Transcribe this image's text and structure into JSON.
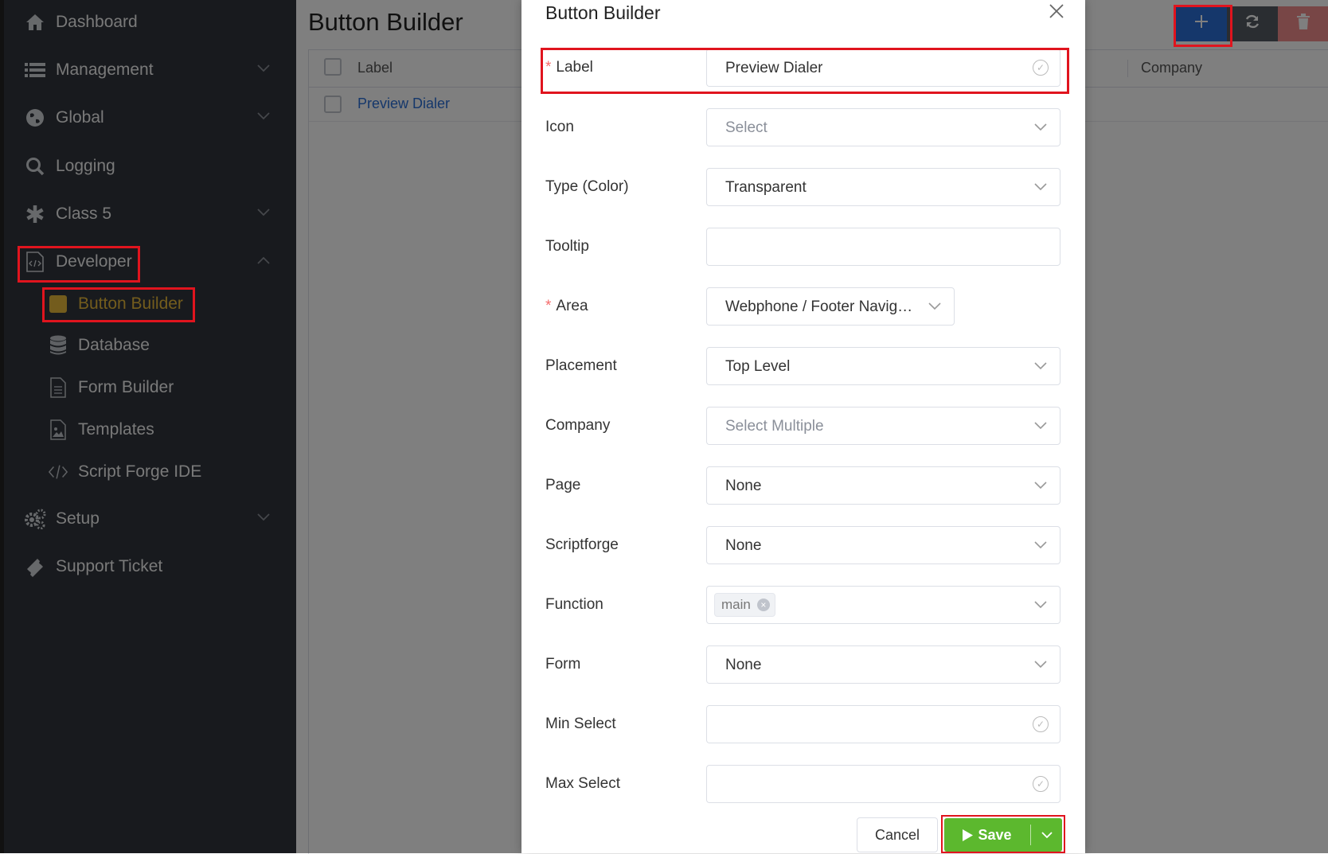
{
  "sidebar": {
    "items": [
      {
        "label": "Dashboard",
        "icon": "home-icon"
      },
      {
        "label": "Management",
        "icon": "list-icon"
      },
      {
        "label": "Global",
        "icon": "globe-icon"
      },
      {
        "label": "Logging",
        "icon": "search-icon"
      },
      {
        "label": "Class 5",
        "icon": "asterisk-icon"
      },
      {
        "label": "Developer",
        "icon": "code-file-icon"
      },
      {
        "label": "Setup",
        "icon": "gears-icon"
      },
      {
        "label": "Support Ticket",
        "icon": "ticket-icon"
      }
    ],
    "developer_sub": [
      {
        "label": "Button Builder",
        "icon": "button-builder-icon",
        "active": true
      },
      {
        "label": "Database",
        "icon": "database-icon"
      },
      {
        "label": "Form Builder",
        "icon": "document-icon"
      },
      {
        "label": "Templates",
        "icon": "image-file-icon"
      },
      {
        "label": "Script Forge IDE",
        "icon": "code-icon"
      }
    ]
  },
  "page": {
    "title": "Button Builder",
    "table": {
      "headers": {
        "label": "Label",
        "company": "Company"
      },
      "rows": [
        {
          "label": "Preview Dialer"
        }
      ]
    },
    "toolbar": {
      "add_icon": "plus-icon",
      "refresh_icon": "refresh-icon",
      "delete_icon": "trash-icon"
    }
  },
  "modal": {
    "title": "Button Builder",
    "fields": {
      "label": {
        "label": "Label",
        "value": "Preview Dialer",
        "required": true
      },
      "icon": {
        "label": "Icon",
        "placeholder": "Select"
      },
      "type": {
        "label": "Type (Color)",
        "value": "Transparent"
      },
      "tooltip": {
        "label": "Tooltip",
        "value": ""
      },
      "area": {
        "label": "Area",
        "value": "Webphone / Footer Navig…",
        "required": true
      },
      "placement": {
        "label": "Placement",
        "value": "Top Level"
      },
      "company": {
        "label": "Company",
        "placeholder": "Select Multiple"
      },
      "page": {
        "label": "Page",
        "value": "None"
      },
      "scriptforge": {
        "label": "Scriptforge",
        "value": "None"
      },
      "function": {
        "label": "Function",
        "tag": "main"
      },
      "form": {
        "label": "Form",
        "value": "None"
      },
      "min_select": {
        "label": "Min Select",
        "value": ""
      },
      "max_select": {
        "label": "Max Select",
        "value": ""
      }
    },
    "required_mark": "*",
    "cancel_label": "Cancel",
    "save_label": "Save"
  },
  "colors": {
    "sidebar_bg": "#30353c",
    "active_accent": "#e6b93a",
    "primary_blue": "#2a6fd6",
    "save_green": "#5cb82e",
    "highlight_red": "#e0141e"
  }
}
